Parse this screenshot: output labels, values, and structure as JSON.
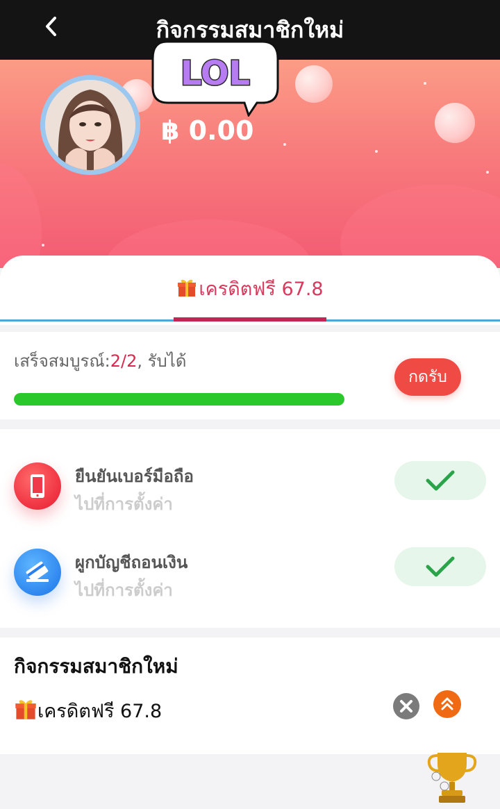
{
  "header": {
    "title": "กิจกรรมสมาชิกใหม่",
    "back_icon": "chevron-left-icon"
  },
  "profile": {
    "sticker_text": "LOL",
    "balance": "฿ 0.00"
  },
  "tabs": [
    {
      "label": "เครดิตฟรี 67.8",
      "icon": "gift-icon",
      "active": true
    }
  ],
  "progress": {
    "prefix": "เสร็จสมบูรณ์:",
    "count": "2/2",
    "suffix": ", รับได้",
    "fraction": 1.0,
    "claim_label": "กดรับ",
    "accent": "#2bc82b"
  },
  "tasks": [
    {
      "title": "ยืนยันเบอร์มือถือ",
      "subtitle": "ไปที่การตั้งค่า",
      "icon": "phone-icon",
      "done": true
    },
    {
      "title": "ผูกบัญชีถอนเงิน",
      "subtitle": "ไปที่การตั้งค่า",
      "icon": "bank-card-icon",
      "done": true
    }
  ],
  "activity": {
    "title": "กิจกรรมสมาชิกใหม่",
    "item_label": "เครดิตฟรี 67.8",
    "close_icon": "close-icon",
    "expand_icon": "double-chevron-up-icon"
  },
  "floating": {
    "icon": "trophy-icon"
  },
  "colors": {
    "brand_pink": "#d83a5e",
    "claim_red": "#ef4a44",
    "hero_top": "#fb9c86",
    "hero_bottom": "#f35a73"
  }
}
